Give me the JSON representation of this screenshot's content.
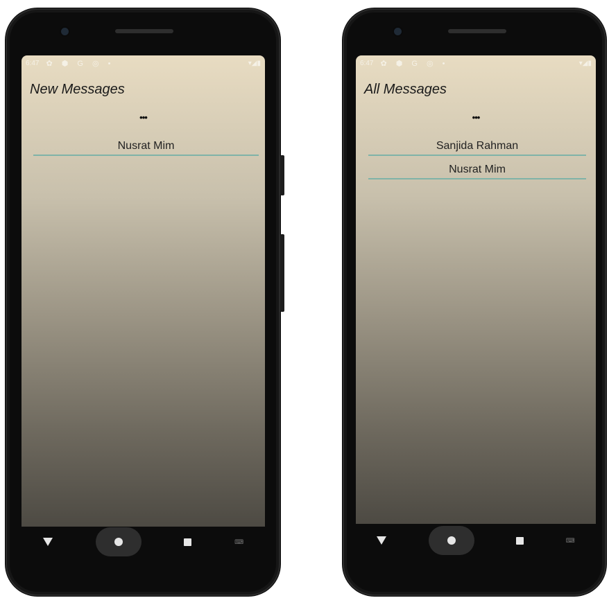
{
  "left_phone": {
    "status": {
      "time": "6:47",
      "icons": "✿ ⬢ G ◎ •",
      "right": "▾◢▮"
    },
    "title": "New Messages",
    "overflow": "•••",
    "messages": [
      "Nusrat Mim"
    ]
  },
  "right_phone": {
    "status": {
      "time": "6:47",
      "icons": "✿ ⬢ G ◎ •",
      "right": "▾◢▮"
    },
    "title": "All Messages",
    "overflow": "•••",
    "messages": [
      "Sanjida Rahman",
      "Nusrat Mim"
    ]
  },
  "nav": {
    "keyboard_glyph": "⌨"
  },
  "colors": {
    "divider": "#7fb3a8",
    "gradient_top": "#e8dcc2",
    "gradient_bottom": "#4d4a43"
  },
  "icons": [
    "back-icon",
    "home-icon",
    "recents-icon",
    "keyboard-icon",
    "overflow-menu-icon"
  ]
}
